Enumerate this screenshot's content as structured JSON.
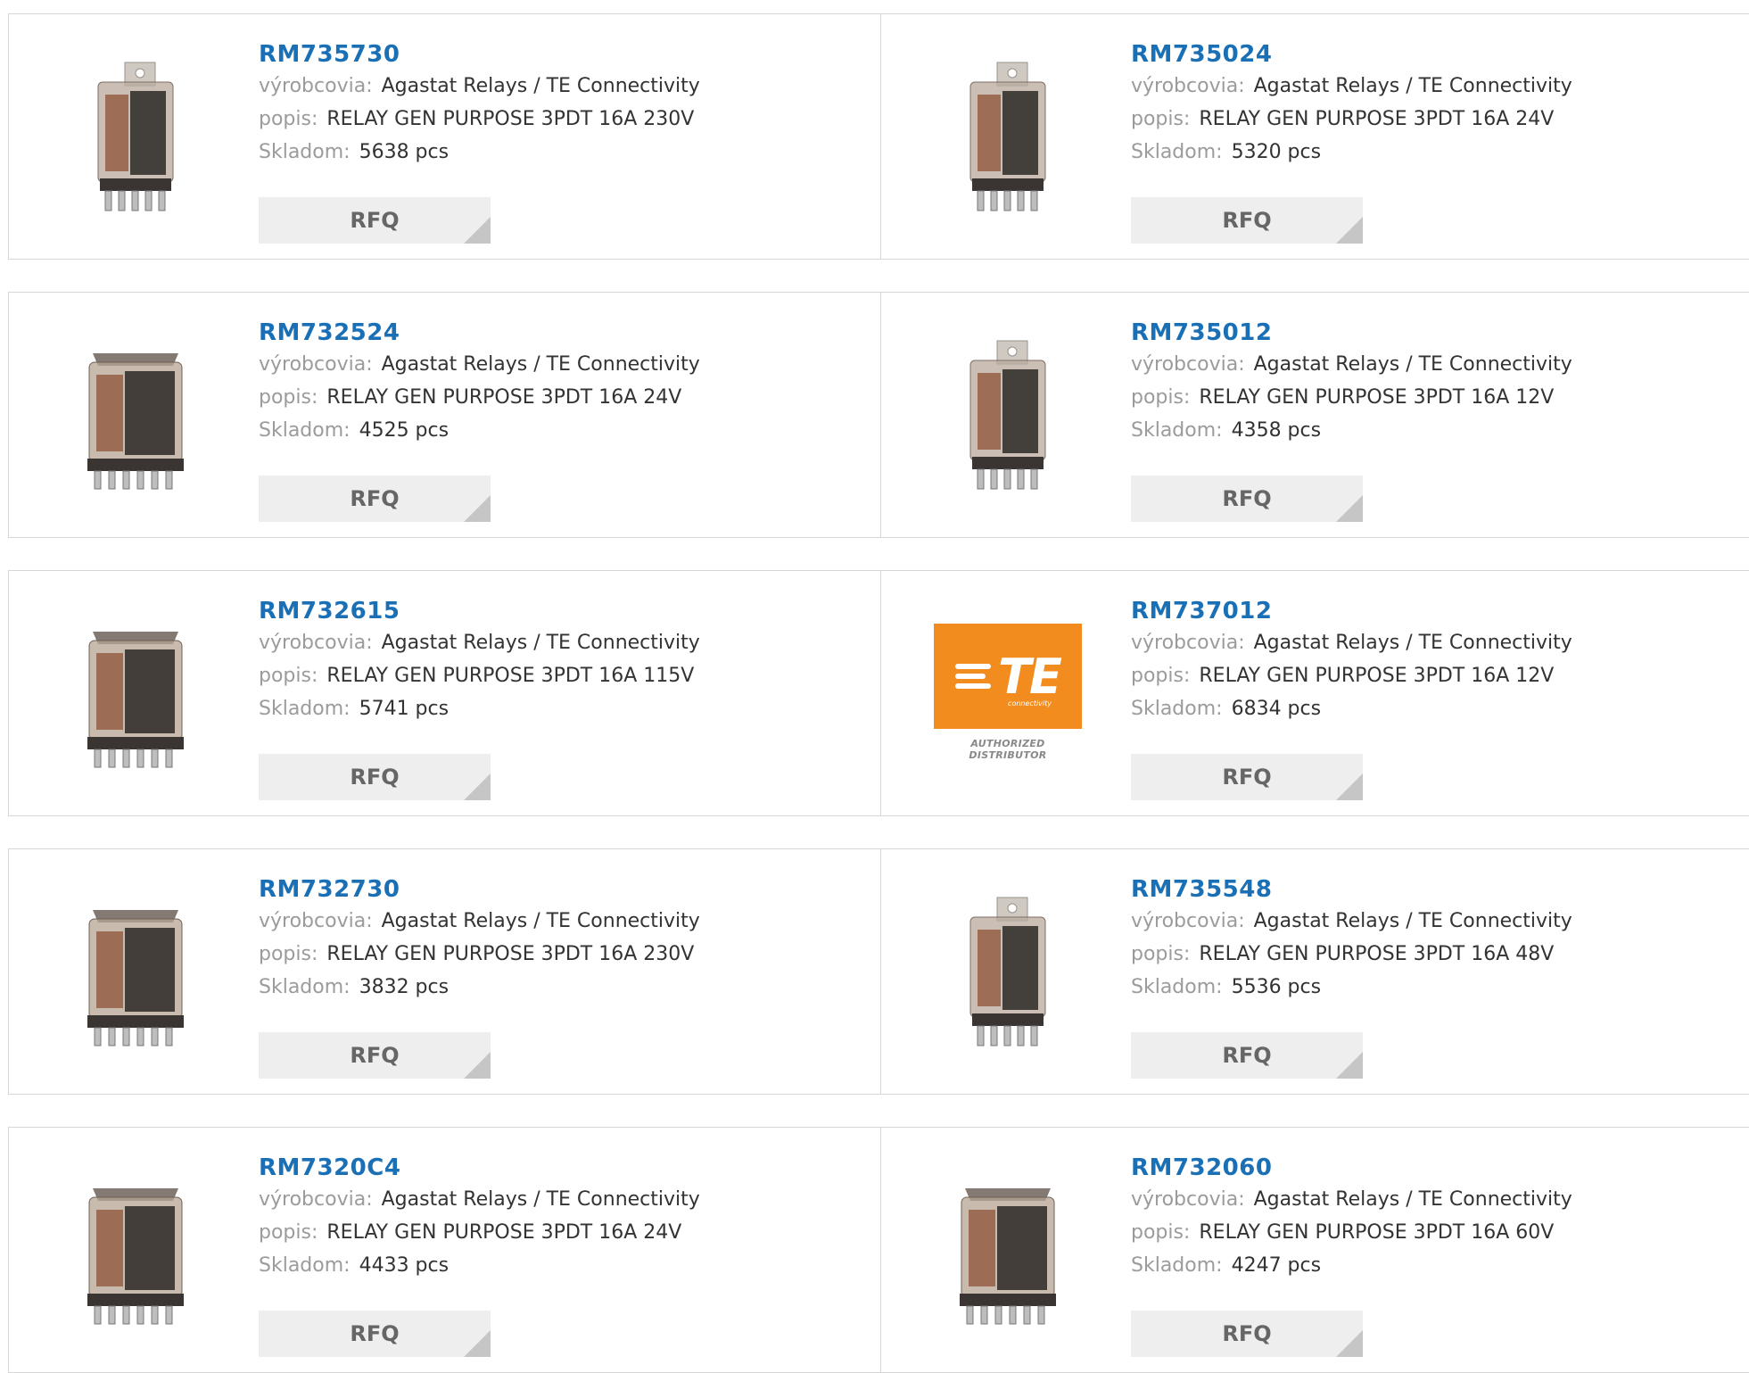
{
  "labels": {
    "manufacturer": "výrobcovia:",
    "description": "popis:",
    "stock": "Skladom:",
    "rfq": "RFQ"
  },
  "colors": {
    "part_link": "#1a6fb5",
    "label": "#9b9b9b",
    "rfq_bg": "#eeeeee",
    "te_orange": "#f28c1f"
  },
  "products": [
    {
      "part": "RM735730",
      "manufacturer": "Agastat Relays / TE Connectivity",
      "description": "RELAY GEN PURPOSE 3PDT 16A 230V",
      "stock": "5638 pcs",
      "image": "relay-tab"
    },
    {
      "part": "RM735024",
      "manufacturer": "Agastat Relays / TE Connectivity",
      "description": "RELAY GEN PURPOSE 3PDT 16A 24V",
      "stock": "5320 pcs",
      "image": "relay-tab"
    },
    {
      "part": "RM732524",
      "manufacturer": "Agastat Relays / TE Connectivity",
      "description": "RELAY GEN PURPOSE 3PDT 16A 24V",
      "stock": "4525 pcs",
      "image": "relay-cube"
    },
    {
      "part": "RM735012",
      "manufacturer": "Agastat Relays / TE Connectivity",
      "description": "RELAY GEN PURPOSE 3PDT 16A 12V",
      "stock": "4358 pcs",
      "image": "relay-tab"
    },
    {
      "part": "RM732615",
      "manufacturer": "Agastat Relays / TE Connectivity",
      "description": "RELAY GEN PURPOSE 3PDT 16A 115V",
      "stock": "5741 pcs",
      "image": "relay-cube"
    },
    {
      "part": "RM737012",
      "manufacturer": "Agastat Relays / TE Connectivity",
      "description": "RELAY GEN PURPOSE 3PDT 16A 12V",
      "stock": "6834 pcs",
      "image": "te-logo"
    },
    {
      "part": "RM732730",
      "manufacturer": "Agastat Relays / TE Connectivity",
      "description": "RELAY GEN PURPOSE 3PDT 16A 230V",
      "stock": "3832 pcs",
      "image": "relay-cube"
    },
    {
      "part": "RM735548",
      "manufacturer": "Agastat Relays / TE Connectivity",
      "description": "RELAY GEN PURPOSE 3PDT 16A 48V",
      "stock": "5536 pcs",
      "image": "relay-tab"
    },
    {
      "part": "RM7320C4",
      "manufacturer": "Agastat Relays / TE Connectivity",
      "description": "RELAY GEN PURPOSE 3PDT 16A 24V",
      "stock": "4433 pcs",
      "image": "relay-cube"
    },
    {
      "part": "RM732060",
      "manufacturer": "Agastat Relays / TE Connectivity",
      "description": "RELAY GEN PURPOSE 3PDT 16A 60V",
      "stock": "4247 pcs",
      "image": "relay-cube"
    }
  ],
  "te_logo": {
    "word": "TE",
    "sub": "connectivity",
    "caption": "AUTHORIZED DISTRIBUTOR"
  }
}
